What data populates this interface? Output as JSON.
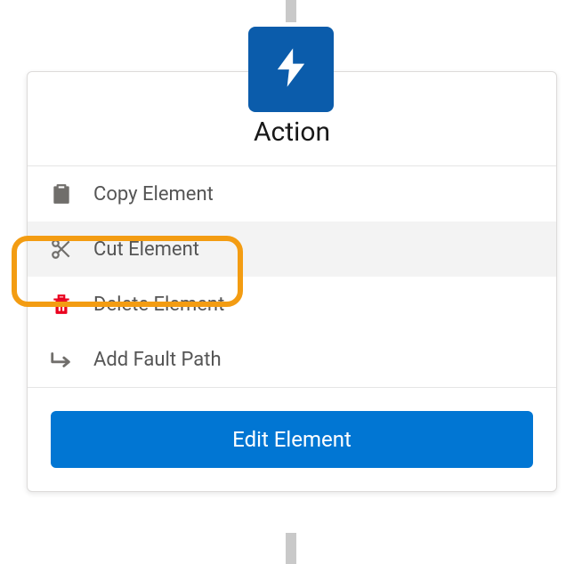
{
  "card": {
    "title": "Action"
  },
  "menu": {
    "copy": {
      "label": "Copy Element"
    },
    "cut": {
      "label": "Cut Element"
    },
    "delete": {
      "label": "Delete Element"
    },
    "fault": {
      "label": "Add Fault Path"
    }
  },
  "footer": {
    "edit_label": "Edit Element"
  },
  "colors": {
    "primary": "#0176d3",
    "badge": "#0b5cab",
    "danger": "#ea001e",
    "highlight": "#f39c12"
  }
}
